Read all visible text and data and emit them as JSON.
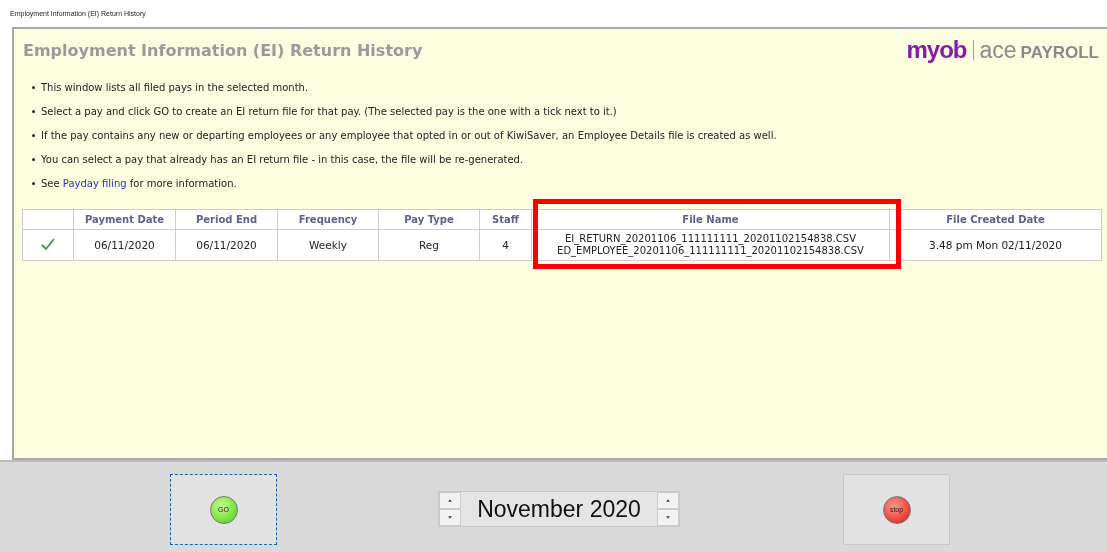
{
  "window": {
    "title": "Employment Information (EI) Return History"
  },
  "header": {
    "title": "Employment Information (EI) Return History",
    "logo": {
      "brand": "myob",
      "product_light": "ace",
      "product_bold": "PAYROLL"
    }
  },
  "notes": [
    {
      "kind": "text",
      "text": "This window lists all filed pays in the selected month."
    },
    {
      "kind": "text",
      "text": "Select a pay and click GO to create an EI return file for that pay. (The selected pay is the one with a tick next to it.)"
    },
    {
      "kind": "text",
      "text": "If the pay contains any new or departing employees or any employee that opted in or out of KiwiSaver, an Employee Details file is created as well."
    },
    {
      "kind": "text",
      "text": "You can select a pay that already has an EI return file - in this case, the file will be re-generated."
    },
    {
      "kind": "link",
      "before": "See ",
      "link": "Payday filing",
      "after": " for more information."
    }
  ],
  "table": {
    "columns": [
      "Payment Date",
      "Period End",
      "Frequency",
      "Pay Type",
      "Staff",
      "File Name",
      "File Created Date"
    ],
    "rows": [
      {
        "selected": true,
        "payment_date": "06/11/2020",
        "period_end": "06/11/2020",
        "frequency": "Weekly",
        "pay_type": "Reg",
        "staff": "4",
        "file_names": [
          "EI_RETURN_20201106_111111111_20201102154838.CSV",
          "ED_EMPLOYEE_20201106_111111111_20201102154838.CSV"
        ],
        "file_created": "3.48 pm Mon 02/11/2020",
        "highlighted": true
      }
    ]
  },
  "footer": {
    "go_button": "GO",
    "month": "November 2020",
    "stop_button": "stop"
  }
}
